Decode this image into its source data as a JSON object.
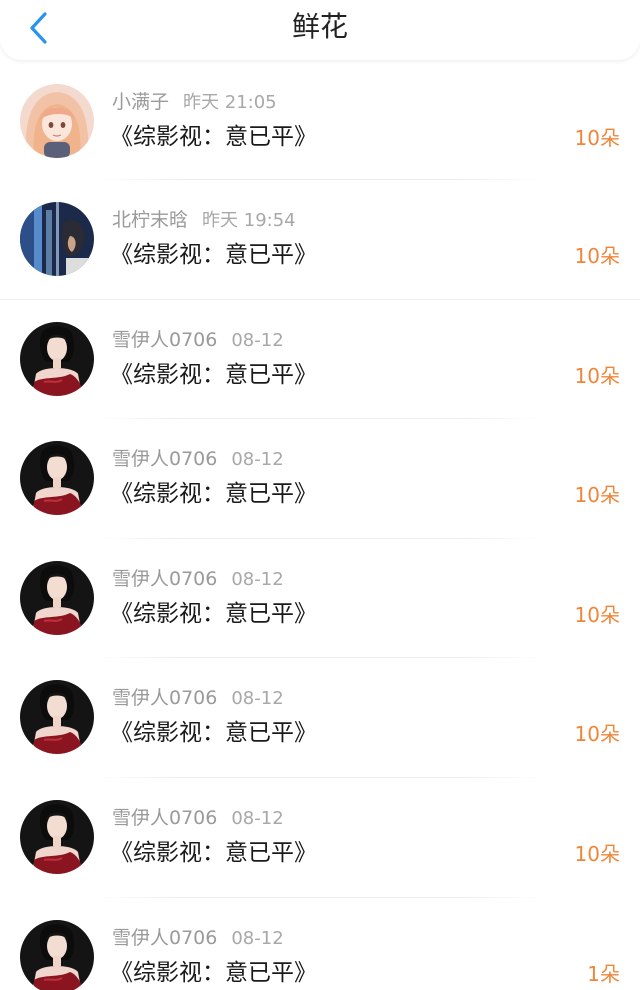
{
  "header": {
    "title": "鲜花"
  },
  "colors": {
    "accent": "#f0863a",
    "back_arrow": "#2a93f0"
  },
  "items": [
    {
      "user": "小满子",
      "time": "昨天 21:05",
      "book": "《综影视：意已平》",
      "count": "10朵",
      "avatar_icon": "anime-girl-avatar"
    },
    {
      "user": "北柠末晗",
      "time": "昨天 19:54",
      "book": "《综影视：意已平》",
      "count": "10朵",
      "avatar_icon": "dark-blue-avatar"
    },
    {
      "user": "雪伊人0706",
      "time": "08-12",
      "book": "《综影视：意已平》",
      "count": "10朵",
      "avatar_icon": "woman-red-dress-avatar"
    },
    {
      "user": "雪伊人0706",
      "time": "08-12",
      "book": "《综影视：意已平》",
      "count": "10朵",
      "avatar_icon": "woman-red-dress-avatar"
    },
    {
      "user": "雪伊人0706",
      "time": "08-12",
      "book": "《综影视：意已平》",
      "count": "10朵",
      "avatar_icon": "woman-red-dress-avatar"
    },
    {
      "user": "雪伊人0706",
      "time": "08-12",
      "book": "《综影视：意已平》",
      "count": "10朵",
      "avatar_icon": "woman-red-dress-avatar"
    },
    {
      "user": "雪伊人0706",
      "time": "08-12",
      "book": "《综影视：意已平》",
      "count": "10朵",
      "avatar_icon": "woman-red-dress-avatar"
    },
    {
      "user": "雪伊人0706",
      "time": "08-12",
      "book": "《综影视：意已平》",
      "count": "1朵",
      "avatar_icon": "woman-red-dress-avatar"
    }
  ]
}
